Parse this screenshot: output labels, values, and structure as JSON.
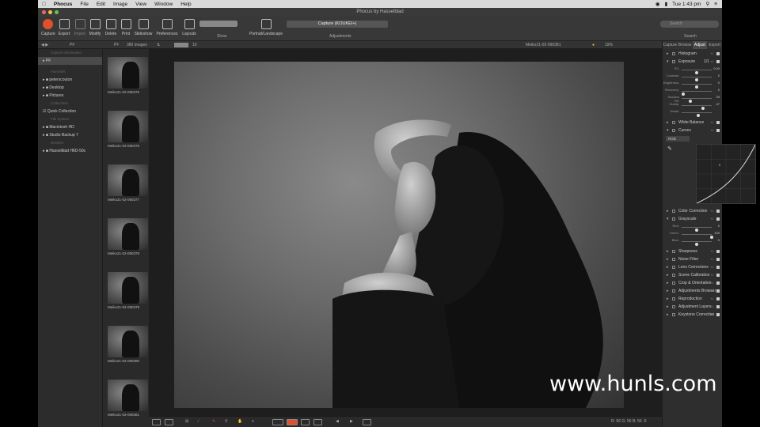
{
  "menubar": {
    "items": [
      "Phocus",
      "File",
      "Edit",
      "Image",
      "View",
      "Window",
      "Help"
    ],
    "time": "Tue 1:43 pm"
  },
  "window": {
    "title": "Phocus by Hasselblad"
  },
  "toolbar": {
    "buttons": [
      "Capture",
      "Export",
      "Import",
      "Modify",
      "Delete",
      "Print",
      "Slideshow",
      "Preferences",
      "Layouts"
    ],
    "show_label": "Show",
    "portrait_label": "Portrait/Landscape",
    "capture_dropdown": "Capture (KOUKEI+)",
    "adjustments_label": "Adjustments",
    "search_label": "Search",
    "search_placeholder": "Search"
  },
  "subbar": {
    "folder": "PF",
    "image_count": "380 images",
    "filename": "Meiko21-02-090381",
    "zoom": "19%",
    "sort_value": "16"
  },
  "sidebar": {
    "capture_destination": "Capture destination",
    "root": "PF",
    "favorites_header": "Favorites",
    "favorites": [
      "peterscouton",
      "Desktop",
      "Pictures"
    ],
    "collections_header": "Collections",
    "collections": [
      "Quick Collection"
    ],
    "filesystem_header": "File System",
    "filesystem": [
      "Macintosh HD",
      "Studio Backup 7"
    ],
    "devices_header": "Devices",
    "devices": [
      "Hasselblad H6D-50c"
    ]
  },
  "thumbnails": [
    "Meiko21-02-090375",
    "Meiko21-02-090376",
    "Meiko21-02-090377",
    "Meiko21-02-090378",
    "Meiko21-02-090379",
    "Meiko21-02-090380",
    "Meiko21-02-090381"
  ],
  "right_panel": {
    "tabs": [
      "Capture",
      "Browse",
      "Adjust",
      "Export"
    ],
    "active_tab": "Adjust",
    "sections_top": [
      "Histogram",
      "Exposure"
    ],
    "exposure_preset": "1/1",
    "exposure_sliders": [
      {
        "name": "EV",
        "value": "0.00",
        "level": 0.5
      },
      {
        "name": "Contrast",
        "value": "0",
        "level": 0.5
      },
      {
        "name": "Brightness",
        "value": "0",
        "level": 0.5
      },
      {
        "name": "Recovery",
        "value": "0",
        "level": 0.05
      },
      {
        "name": "Shadow Fill",
        "value": "29",
        "level": 0.3
      },
      {
        "name": "Clarity",
        "value": "47",
        "level": 0.72
      },
      {
        "name": "Detail",
        "value": "",
        "level": 0.55
      }
    ],
    "white_balance": "White Balance",
    "curves": "Curves",
    "curves_channel": "RGB",
    "curves_value": "0",
    "color_correction": "Color Correction",
    "grayscale": "Grayscale",
    "grayscale_sliders": [
      {
        "name": "Red",
        "value": "0",
        "level": 0.5
      },
      {
        "name": "Green",
        "value": "100",
        "level": 1.0
      },
      {
        "name": "Blue",
        "value": "0",
        "level": 0.5
      }
    ],
    "sections_bottom": [
      "Sharpness",
      "Noise Filter",
      "Lens Corrections",
      "Scene Calibration",
      "Crop & Orientation",
      "Adjustments Browser",
      "Reproduction",
      "Adjustment Layers",
      "Keystone Correction"
    ],
    "plus_minus": "+/-"
  },
  "bottombar": {
    "readout": "R: 56  G: 56  B: 56  -0"
  },
  "watermark": "www.hunls.com"
}
